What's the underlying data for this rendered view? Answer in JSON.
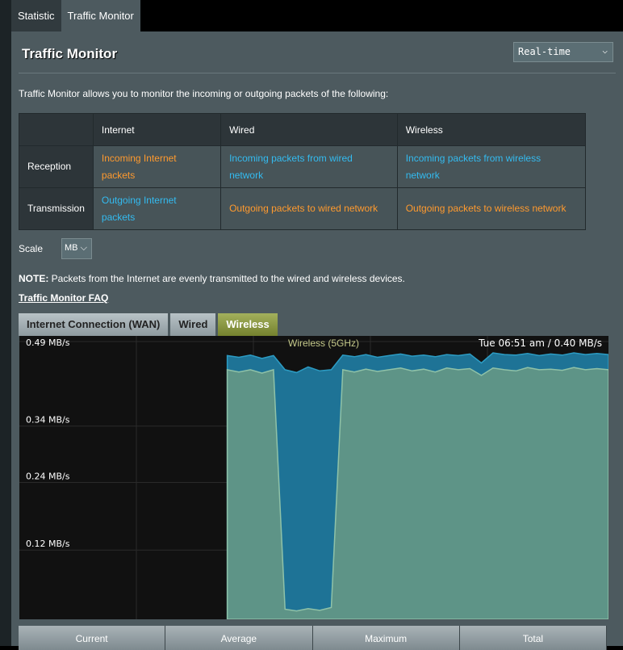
{
  "tabs": [
    {
      "label": "Statistic"
    },
    {
      "label": "Traffic Monitor"
    }
  ],
  "title": "Traffic Monitor",
  "period_select": "Real-time",
  "description": "Traffic Monitor allows you to monitor the incoming or outgoing packets of the following:",
  "table": {
    "headers": [
      "",
      "Internet",
      "Wired",
      "Wireless"
    ],
    "rows": [
      {
        "label": "Reception",
        "cells": [
          "Incoming Internet packets",
          "Incoming packets from wired network",
          "Incoming packets from wireless network"
        ]
      },
      {
        "label": "Transmission",
        "cells": [
          "Outgoing Internet packets",
          "Outgoing packets to wired network",
          "Outgoing packets to wireless network"
        ]
      }
    ]
  },
  "scale": {
    "label": "Scale",
    "value": "MB"
  },
  "note": {
    "bold": "NOTE:",
    "text": " Packets from the Internet are evenly transmitted to the wired and wireless devices."
  },
  "faq_link": "Traffic Monitor FAQ",
  "graph_tabs": [
    {
      "label": "Internet Connection (WAN)"
    },
    {
      "label": "Wired"
    },
    {
      "label": "Wireless"
    }
  ],
  "colors": {
    "rx": "#1e7396",
    "tx": "#5e9487",
    "accent": "#8a9a3e",
    "orange": "#ff9a2e",
    "blue": "#33bbf0"
  },
  "chart_data": {
    "type": "area",
    "title": "Wireless (5GHz)",
    "readout": "Tue 06:51 am / 0.40 MB/s",
    "ylabel": "MB/s",
    "ytick_labels": [
      "0.49 MB/s",
      "0.34 MB/s",
      "0.24 MB/s",
      "0.12 MB/s"
    ],
    "yticks": [
      0.49,
      0.34,
      0.24,
      0.12
    ],
    "ylim": [
      0,
      0.49
    ],
    "series": [
      {
        "name": "Reception",
        "values": [
          null,
          null,
          null,
          null,
          null,
          null,
          null,
          null,
          null,
          null,
          null,
          null,
          null,
          null,
          null,
          null,
          null,
          null,
          0.465,
          0.462,
          0.466,
          0.46,
          0.465,
          0.44,
          0.435,
          0.445,
          0.438,
          0.44,
          0.466,
          0.463,
          0.467,
          0.462,
          0.465,
          0.468,
          0.464,
          0.466,
          0.463,
          0.467,
          0.465,
          0.468,
          0.452,
          0.47,
          0.467,
          0.466,
          0.469,
          0.465,
          0.468,
          0.466,
          0.47,
          0.467,
          0.469,
          0.467
        ]
      },
      {
        "name": "Transmission",
        "values": [
          null,
          null,
          null,
          null,
          null,
          null,
          null,
          null,
          null,
          null,
          null,
          null,
          null,
          null,
          null,
          null,
          null,
          null,
          0.44,
          0.436,
          0.44,
          0.434,
          0.44,
          0.015,
          0.012,
          0.016,
          0.013,
          0.018,
          0.44,
          0.436,
          0.441,
          0.437,
          0.44,
          0.443,
          0.438,
          0.441,
          0.436,
          0.443,
          0.44,
          0.442,
          0.43,
          0.443,
          0.44,
          0.438,
          0.444,
          0.44,
          0.441,
          0.439,
          0.444,
          0.44,
          0.442,
          0.44
        ]
      }
    ]
  },
  "stats_headers": [
    "Current",
    "Average",
    "Maximum",
    "Total"
  ]
}
